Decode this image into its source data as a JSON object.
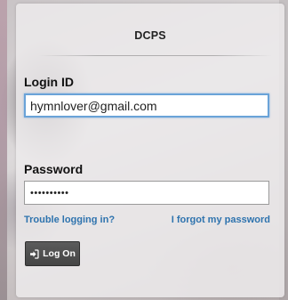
{
  "panel": {
    "title": "DCPS"
  },
  "login": {
    "label": "Login ID",
    "value": "hymnlover@gmail.com"
  },
  "password": {
    "label": "Password",
    "value": "••••••••••"
  },
  "links": {
    "trouble": "Trouble logging in?",
    "forgot": "I forgot my password"
  },
  "logon_button": {
    "label": "Log On",
    "icon": "sign-in-icon"
  },
  "colors": {
    "link": "#2e73ae",
    "focus_border": "#6aa3d8",
    "button_bg": "#4f4f4f"
  }
}
